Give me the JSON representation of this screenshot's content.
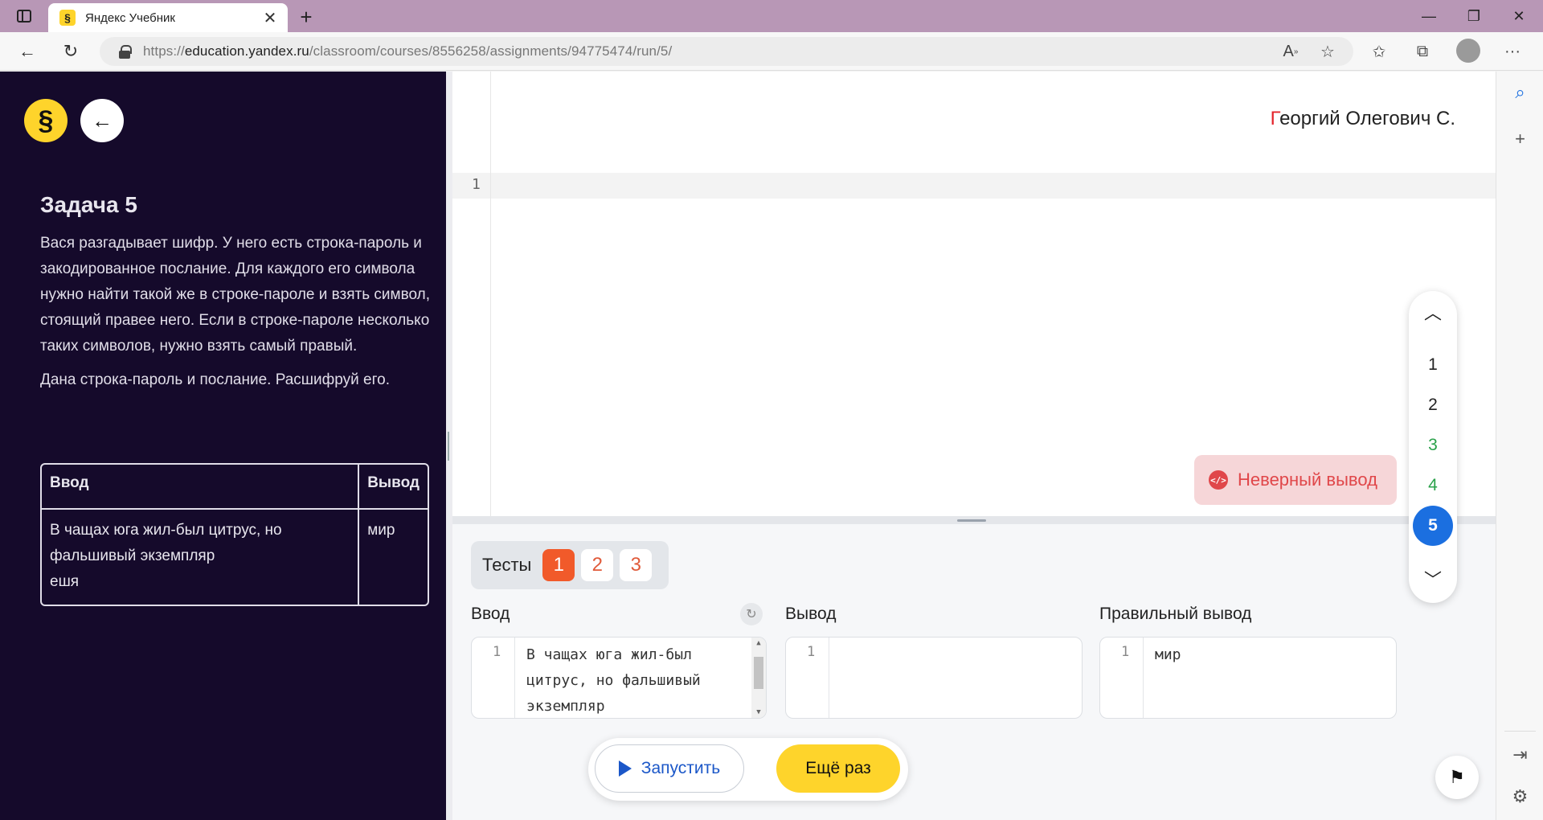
{
  "browser": {
    "tab_title": "Яндекс Учебник",
    "tab_favicon": "§",
    "url_prefix": "https://",
    "url_host": "education.yandex.ru",
    "url_path": "/classroom/courses/8556258/assignments/94775474/run/5/"
  },
  "task": {
    "title": "Задача 5",
    "paragraph1": "Вася разгадывает шифр. У него есть строка-пароль и закодированное послание. Для каждого его символа нужно найти такой же в строке-пароле и взять символ, стоящий правее него. Если в строке-пароле несколько таких символов, нужно взять самый правый.",
    "paragraph2": "Дана строка-пароль и послание. Расшифруй его.",
    "table": {
      "head_input": "Ввод",
      "head_output": "Вывод",
      "input_line1": "В чащах юга жил-был цитрус, но фальшивый экземпляр",
      "input_line2": "ешя",
      "output": "мир"
    }
  },
  "editor": {
    "line_number": "1",
    "author_first_letter": "Г",
    "author_rest": "еоргий Олегович С.",
    "verdict": "Неверный вывод",
    "verdict_icon": "</>"
  },
  "task_nav": {
    "items": [
      "1",
      "2",
      "3",
      "4",
      "5"
    ],
    "solved": [
      "3",
      "4"
    ],
    "active": "5"
  },
  "tests": {
    "label": "Тесты",
    "items": [
      "1",
      "2",
      "3"
    ],
    "active": "1",
    "input_label": "Ввод",
    "output_label": "Вывод",
    "expected_label": "Правильный вывод",
    "input_text": "В чащах юга жил-был цитрус, но фальшивый экземпляр",
    "input_line_number": "1",
    "output_text": "",
    "output_line_number": "1",
    "expected_text": "мир",
    "expected_line_number": "1"
  },
  "actions": {
    "run_label": "Запустить",
    "again_label": "Ещё раз"
  },
  "colors": {
    "left_panel_bg": "#150a2b",
    "accent_yellow": "#fed42b",
    "active_blue": "#1b6fe0",
    "error_red": "#e0474a",
    "test_chip_orange": "#f15a2a",
    "solved_green": "#2aa14a"
  }
}
